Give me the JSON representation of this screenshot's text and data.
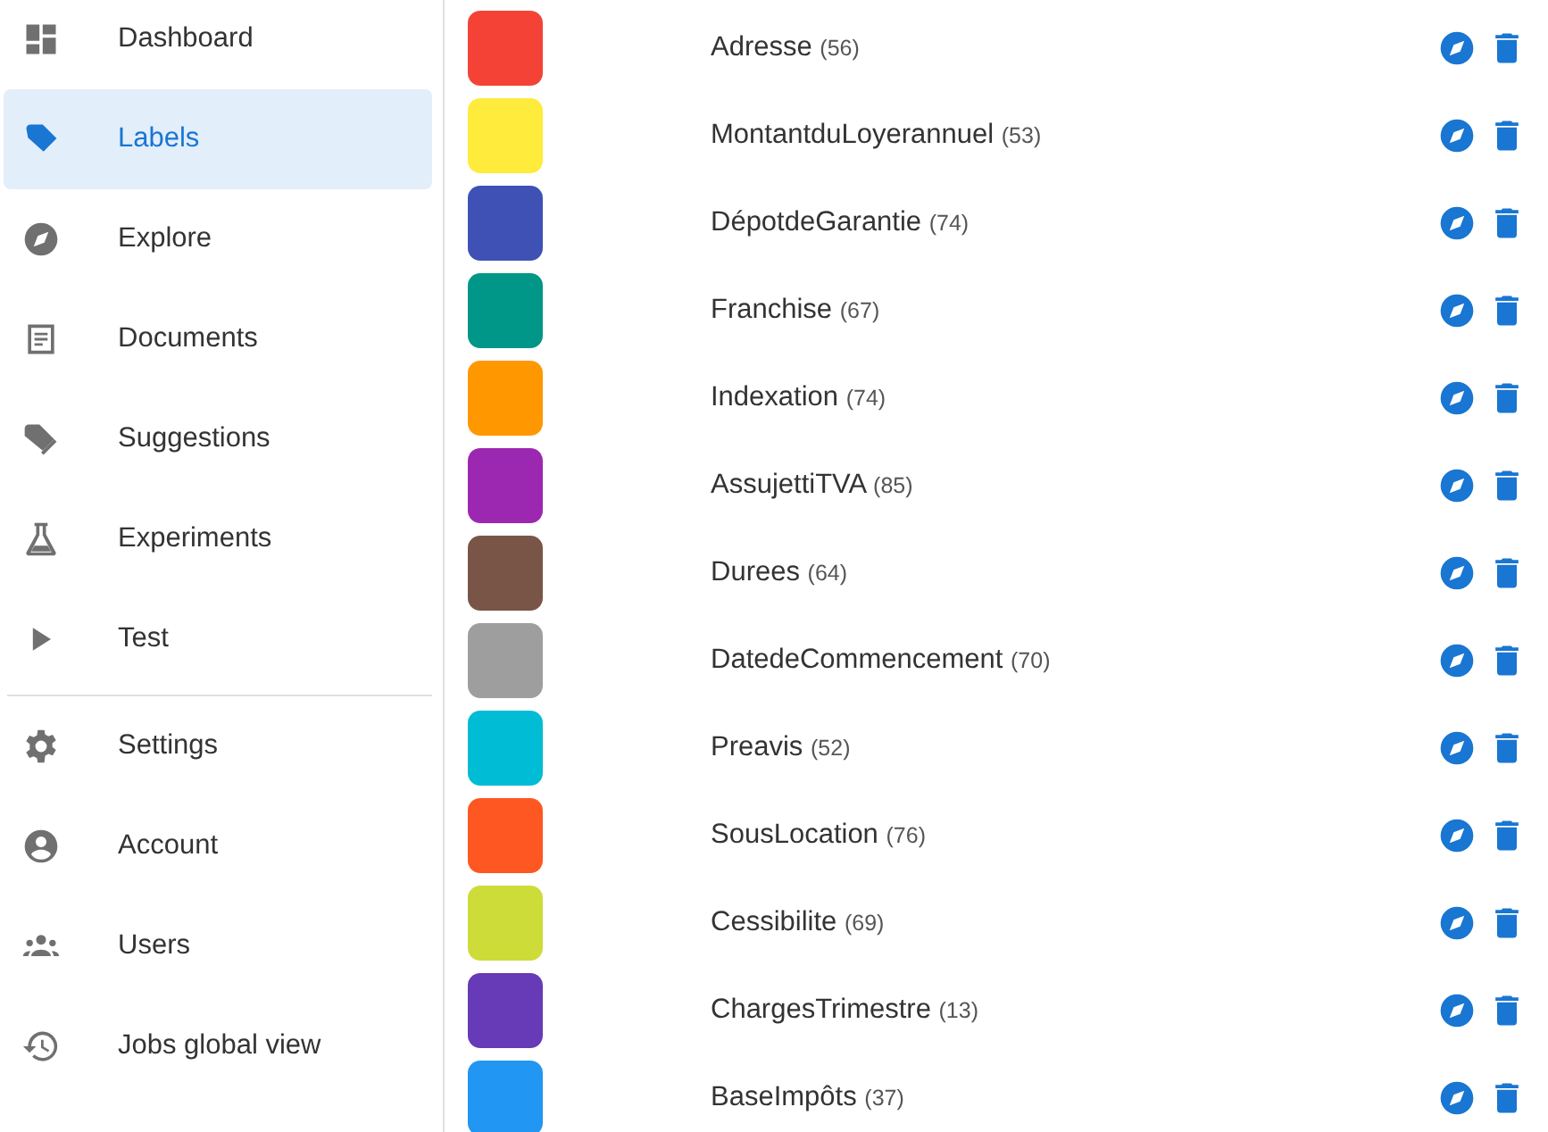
{
  "sidebar": {
    "items": [
      {
        "label": "Dashboard",
        "selected": false
      },
      {
        "label": "Labels",
        "selected": true
      },
      {
        "label": "Explore",
        "selected": false
      },
      {
        "label": "Documents",
        "selected": false
      },
      {
        "label": "Suggestions",
        "selected": false
      },
      {
        "label": "Experiments",
        "selected": false
      },
      {
        "label": "Test",
        "selected": false
      }
    ],
    "bottom_items": [
      {
        "label": "Settings",
        "selected": false
      },
      {
        "label": "Account",
        "selected": false
      },
      {
        "label": "Users",
        "selected": false
      },
      {
        "label": "Jobs global view",
        "selected": false
      }
    ]
  },
  "labels": [
    {
      "name": "Adresse",
      "count": "(56)",
      "color": "#f44336"
    },
    {
      "name": "MontantduLoyerannuel",
      "count": "(53)",
      "color": "#ffeb3b"
    },
    {
      "name": "DépotdeGarantie",
      "count": "(74)",
      "color": "#3f51b5"
    },
    {
      "name": "Franchise",
      "count": "(67)",
      "color": "#009688"
    },
    {
      "name": "Indexation",
      "count": "(74)",
      "color": "#ff9800"
    },
    {
      "name": "AssujettiTVA",
      "count": "(85)",
      "color": "#9c27b0"
    },
    {
      "name": "Durees",
      "count": "(64)",
      "color": "#795548"
    },
    {
      "name": "DatedeCommencement",
      "count": "(70)",
      "color": "#9e9e9e"
    },
    {
      "name": "Preavis",
      "count": "(52)",
      "color": "#00bcd4"
    },
    {
      "name": "SousLocation",
      "count": "(76)",
      "color": "#ff5722"
    },
    {
      "name": "Cessibilite",
      "count": "(69)",
      "color": "#cddc39"
    },
    {
      "name": "ChargesTrimestre",
      "count": "(13)",
      "color": "#673ab7"
    },
    {
      "name": "BaseImpôts",
      "count": "(37)",
      "color": "#2196f3"
    }
  ]
}
